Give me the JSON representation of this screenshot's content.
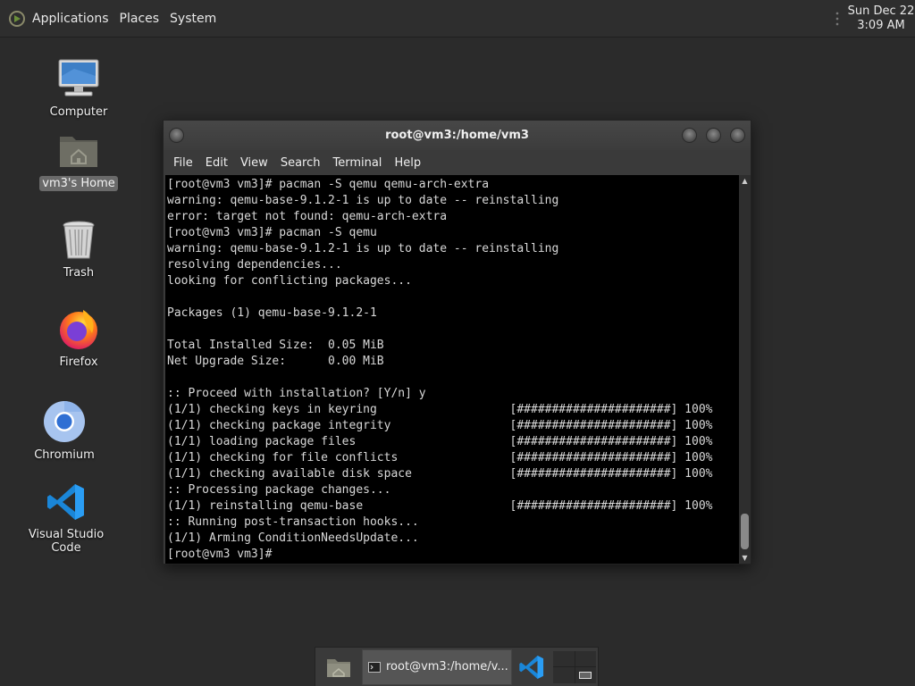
{
  "top_panel": {
    "menus": [
      "Applications",
      "Places",
      "System"
    ],
    "clock": {
      "date": "Sun Dec 22",
      "time": "3:09 AM"
    }
  },
  "desktop_icons": [
    {
      "label": "Computer",
      "icon": "computer-icon"
    },
    {
      "label": "vm3's Home",
      "icon": "home-folder-icon",
      "selected": true
    },
    {
      "label": "Trash",
      "icon": "trash-icon"
    },
    {
      "label": "Firefox",
      "icon": "firefox-icon"
    },
    {
      "label": "Chromium",
      "icon": "chromium-icon"
    },
    {
      "label": "Visual Studio Code",
      "icon": "vscode-icon"
    }
  ],
  "terminal": {
    "title": "root@vm3:/home/vm3",
    "menu": [
      "File",
      "Edit",
      "View",
      "Search",
      "Terminal",
      "Help"
    ],
    "lines": [
      "[root@vm3 vm3]# pacman -S qemu qemu-arch-extra",
      "warning: qemu-base-9.1.2-1 is up to date -- reinstalling",
      "error: target not found: qemu-arch-extra",
      "[root@vm3 vm3]# pacman -S qemu",
      "warning: qemu-base-9.1.2-1 is up to date -- reinstalling",
      "resolving dependencies...",
      "looking for conflicting packages...",
      "",
      "Packages (1) qemu-base-9.1.2-1",
      "",
      "Total Installed Size:  0.05 MiB",
      "Net Upgrade Size:      0.00 MiB",
      "",
      ":: Proceed with installation? [Y/n] y",
      "(1/1) checking keys in keyring                   [######################] 100%",
      "(1/1) checking package integrity                 [######################] 100%",
      "(1/1) loading package files                      [######################] 100%",
      "(1/1) checking for file conflicts                [######################] 100%",
      "(1/1) checking available disk space              [######################] 100%",
      ":: Processing package changes...",
      "(1/1) reinstalling qemu-base                     [######################] 100%",
      ":: Running post-transaction hooks...",
      "(1/1) Arming ConditionNeedsUpdate...",
      "[root@vm3 vm3]#"
    ]
  },
  "taskbar": {
    "task_label": "root@vm3:/home/v..."
  },
  "colors": {
    "desktop": "#2b2b2b",
    "panel": "#2e2e2e",
    "terminal_bg": "#000000",
    "terminal_fg": "#d8d8d8"
  }
}
